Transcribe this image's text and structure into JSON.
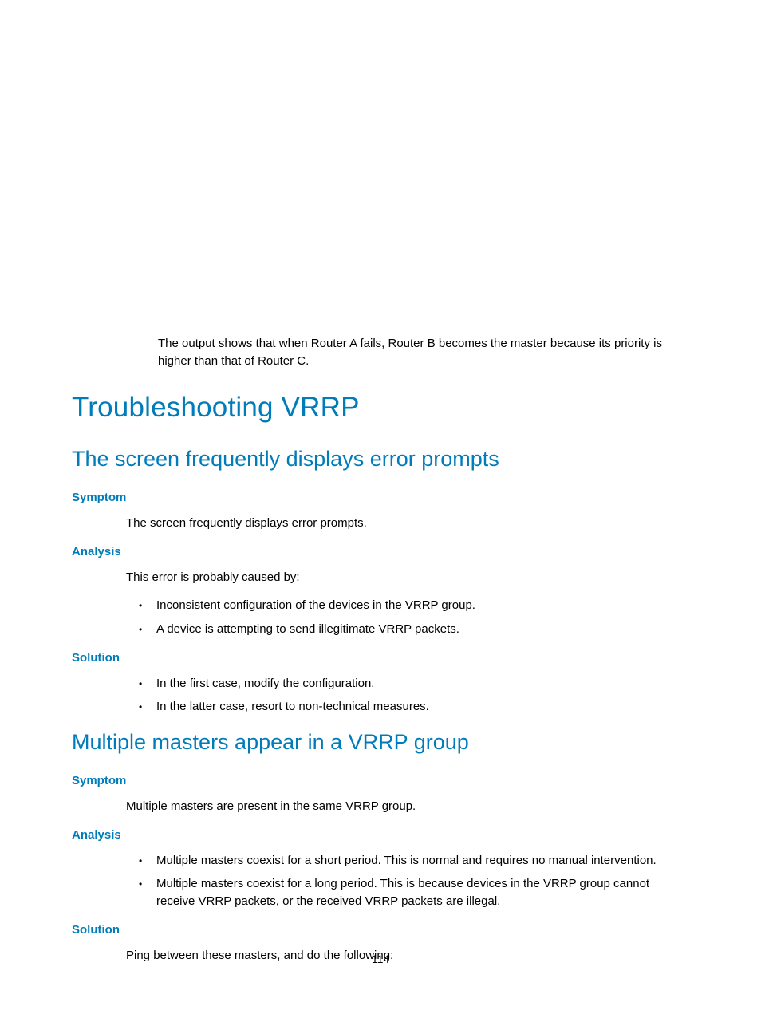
{
  "intro_paragraph": "The output shows that when Router A fails, Router B becomes the master because its priority is higher than that of Router C.",
  "h1": "Troubleshooting VRRP",
  "section1": {
    "h2": "The screen frequently displays error prompts",
    "symptom_label": "Symptom",
    "symptom_text": "The screen frequently displays error prompts.",
    "analysis_label": "Analysis",
    "analysis_intro": "This error is probably caused by:",
    "analysis_bullets": [
      "Inconsistent configuration of the devices in the VRRP group.",
      "A device is attempting to send illegitimate VRRP packets."
    ],
    "solution_label": "Solution",
    "solution_bullets": [
      "In the first case, modify the configuration.",
      "In the latter case, resort to non-technical measures."
    ]
  },
  "section2": {
    "h2": "Multiple masters appear in a VRRP group",
    "symptom_label": "Symptom",
    "symptom_text": "Multiple masters are present in the same VRRP group.",
    "analysis_label": "Analysis",
    "analysis_bullets": [
      "Multiple masters coexist for a short period. This is normal and requires no manual intervention.",
      "Multiple masters coexist for a long period. This is because devices in the VRRP group cannot receive VRRP packets, or the received VRRP packets are illegal."
    ],
    "solution_label": "Solution",
    "solution_text": "Ping between these masters, and do the following:"
  },
  "page_number": "114"
}
